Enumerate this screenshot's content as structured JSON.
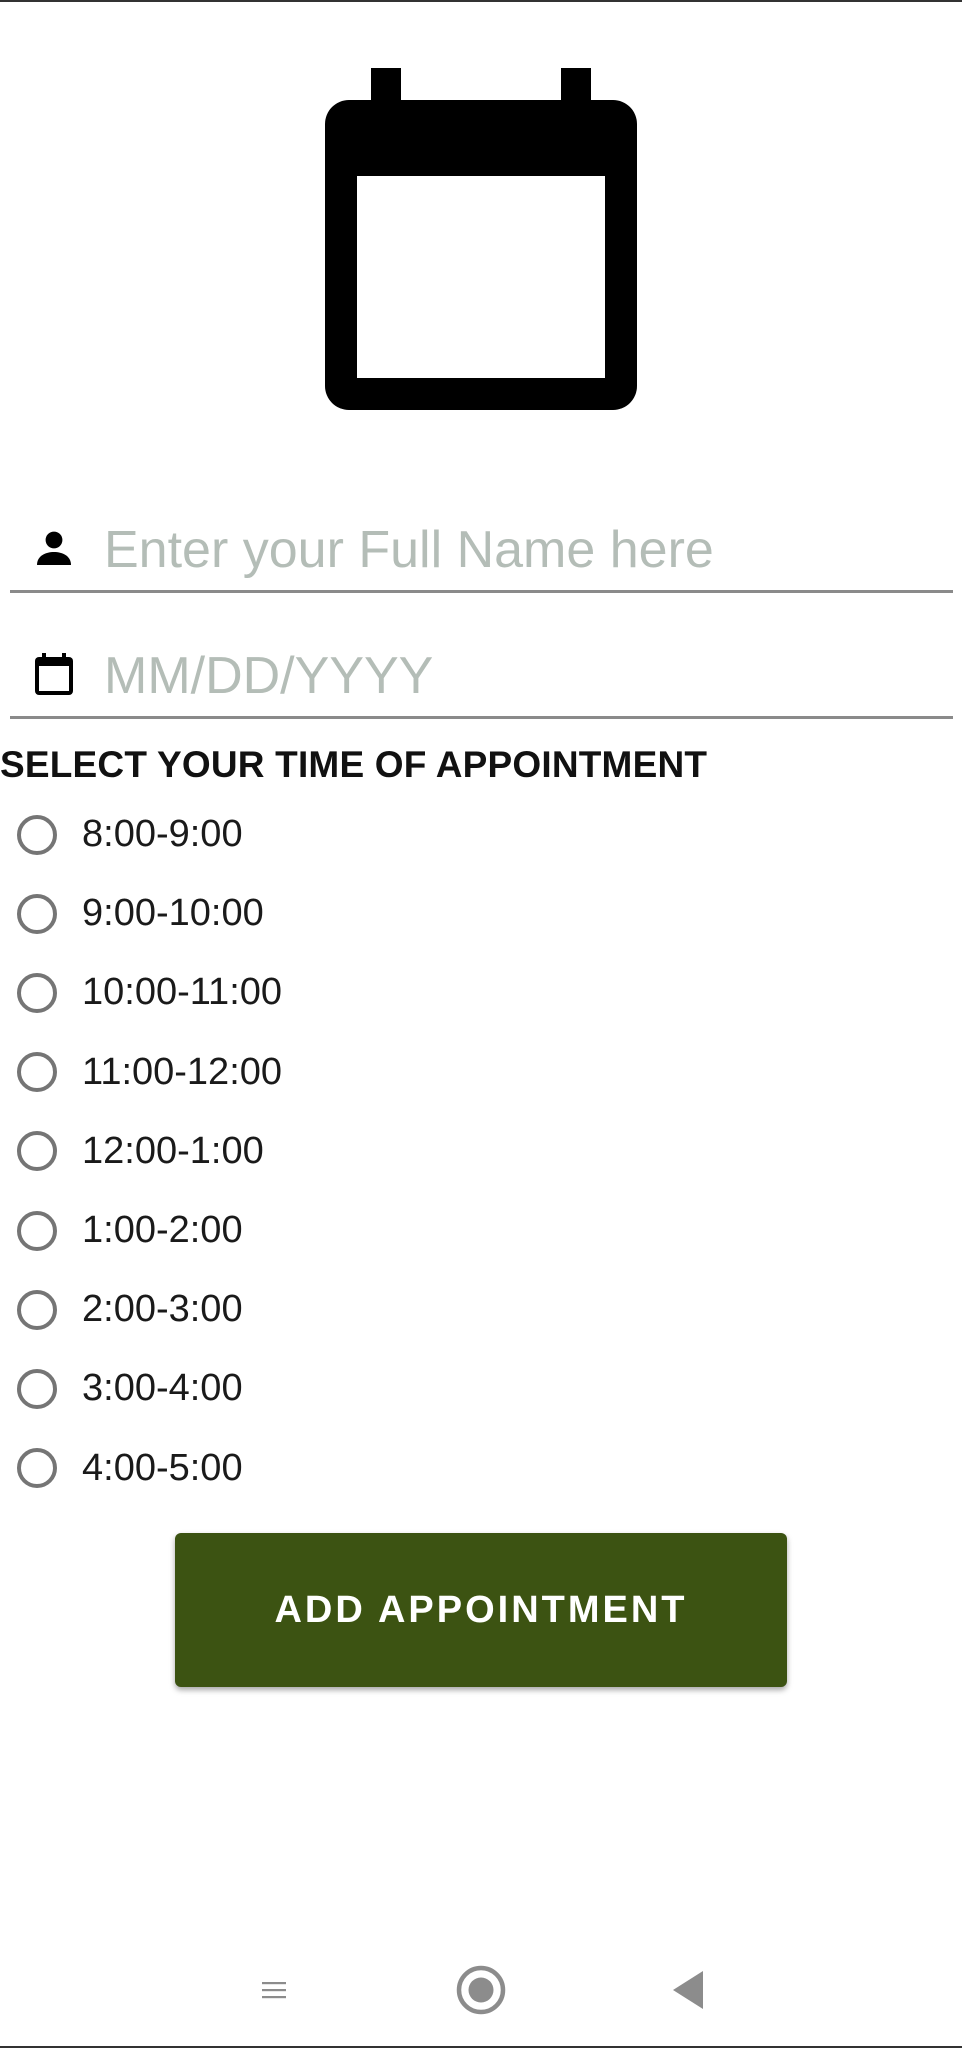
{
  "header": {
    "icon": "calendar-icon"
  },
  "form": {
    "name_field": {
      "icon": "person-icon",
      "placeholder": "Enter your Full Name here",
      "value": ""
    },
    "date_field": {
      "icon": "calendar-icon",
      "placeholder": "MM/DD/YYYY",
      "value": ""
    },
    "section_title": "SELECT YOUR TIME OF APPOINTMENT",
    "time_slots": [
      {
        "label": "8:00-9:00",
        "selected": false
      },
      {
        "label": "9:00-10:00",
        "selected": false
      },
      {
        "label": "10:00-11:00",
        "selected": false
      },
      {
        "label": "11:00-12:00",
        "selected": false
      },
      {
        "label": "12:00-1:00",
        "selected": false
      },
      {
        "label": "1:00-2:00",
        "selected": false
      },
      {
        "label": "2:00-3:00",
        "selected": false
      },
      {
        "label": "3:00-4:00",
        "selected": false
      },
      {
        "label": "4:00-5:00",
        "selected": false
      }
    ],
    "submit_label": "ADD APPOINTMENT"
  },
  "navbar": {
    "menu_icon": "menu-icon",
    "home_icon": "home-icon",
    "back_icon": "back-icon"
  },
  "colors": {
    "button_background": "#3c5312",
    "button_text": "#ffffff",
    "placeholder_text": "#b4bdb7",
    "underline": "#8a8a8a",
    "radio_border": "#757575"
  }
}
